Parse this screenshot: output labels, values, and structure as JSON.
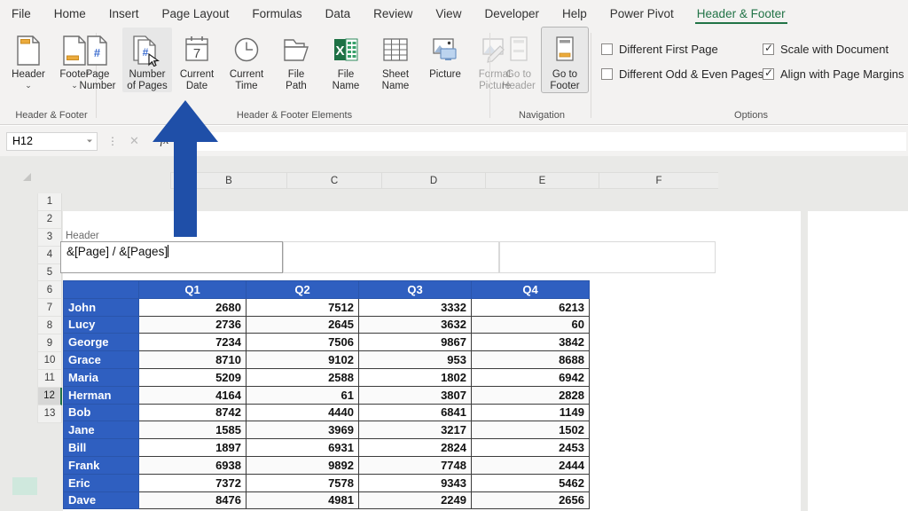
{
  "ribbon": {
    "tabs": [
      {
        "label": "File",
        "active": false
      },
      {
        "label": "Home",
        "active": false
      },
      {
        "label": "Insert",
        "active": false
      },
      {
        "label": "Page Layout",
        "active": false
      },
      {
        "label": "Formulas",
        "active": false
      },
      {
        "label": "Data",
        "active": false
      },
      {
        "label": "Review",
        "active": false
      },
      {
        "label": "View",
        "active": false
      },
      {
        "label": "Developer",
        "active": false
      },
      {
        "label": "Help",
        "active": false
      },
      {
        "label": "Power Pivot",
        "active": false
      },
      {
        "label": "Header & Footer",
        "active": true
      }
    ],
    "accent_green": "#217346",
    "groups": [
      {
        "name": "header-footer",
        "label": "Header & Footer"
      },
      {
        "name": "header-footer-elements",
        "label": "Header & Footer Elements"
      },
      {
        "name": "navigation",
        "label": "Navigation"
      },
      {
        "name": "options",
        "label": "Options"
      }
    ],
    "buttons": {
      "header": "Header",
      "footer": "Footer",
      "page_number_l1": "Page",
      "page_number_l2": "Number",
      "number_of_pages_l1": "Number",
      "number_of_pages_l2": "of Pages",
      "current_date_l1": "Current",
      "current_date_l2": "Date",
      "current_time_l1": "Current",
      "current_time_l2": "Time",
      "file_path_l1": "File",
      "file_path_l2": "Path",
      "file_name_l1": "File",
      "file_name_l2": "Name",
      "sheet_name_l1": "Sheet",
      "sheet_name_l2": "Name",
      "picture": "Picture",
      "format_picture_l1": "Format",
      "format_picture_l2": "Picture",
      "go_to_header_l1": "Go to",
      "go_to_header_l2": "Header",
      "go_to_footer_l1": "Go to",
      "go_to_footer_l2": "Footer"
    },
    "options": [
      {
        "label": "Different First Page",
        "checked": false
      },
      {
        "label": "Different Odd & Even Pages",
        "checked": false
      },
      {
        "label": "Scale with Document",
        "checked": true
      },
      {
        "label": "Align with Page Margins",
        "checked": true
      }
    ]
  },
  "formula_bar": {
    "name_box_value": "H12",
    "cancel_icon": "✕",
    "fx_icon": "fx",
    "formula_value": ""
  },
  "sheet": {
    "column_headers": [
      "B",
      "C",
      "D",
      "E",
      "F"
    ],
    "row_headers": [
      "1",
      "2",
      "3",
      "4",
      "5",
      "6",
      "7",
      "8",
      "9",
      "10",
      "11",
      "12",
      "13"
    ],
    "selected_row": "12",
    "header_label": "Header",
    "header_left_text": "&[Page] / &[Pages]",
    "header_center_text": "",
    "header_right_text": ""
  },
  "table": {
    "columns": [
      "",
      "Q1",
      "Q2",
      "Q3",
      "Q4"
    ],
    "rows": [
      {
        "name": "John",
        "values": [
          "2680",
          "7512",
          "3332",
          "6213"
        ]
      },
      {
        "name": "Lucy",
        "values": [
          "2736",
          "2645",
          "3632",
          "60"
        ]
      },
      {
        "name": "George",
        "values": [
          "7234",
          "7506",
          "9867",
          "3842"
        ]
      },
      {
        "name": "Grace",
        "values": [
          "8710",
          "9102",
          "953",
          "8688"
        ]
      },
      {
        "name": "Maria",
        "values": [
          "5209",
          "2588",
          "1802",
          "6942"
        ]
      },
      {
        "name": "Herman",
        "values": [
          "4164",
          "61",
          "3807",
          "2828"
        ]
      },
      {
        "name": "Bob",
        "values": [
          "8742",
          "4440",
          "6841",
          "1149"
        ]
      },
      {
        "name": "Jane",
        "values": [
          "1585",
          "3969",
          "3217",
          "1502"
        ]
      },
      {
        "name": "Bill",
        "values": [
          "1897",
          "6931",
          "2824",
          "2453"
        ]
      },
      {
        "name": "Frank",
        "values": [
          "6938",
          "9892",
          "7748",
          "2444"
        ]
      },
      {
        "name": "Eric",
        "values": [
          "7372",
          "7578",
          "9343",
          "5462"
        ]
      },
      {
        "name": "Dave",
        "values": [
          "8476",
          "4981",
          "2249",
          "2656"
        ]
      }
    ],
    "header_fill": "#2f5fc0",
    "header_text_color": "#ffffff"
  },
  "annotation": {
    "arrow_color": "#1f4fa8",
    "points_to": "number-of-pages-button"
  }
}
